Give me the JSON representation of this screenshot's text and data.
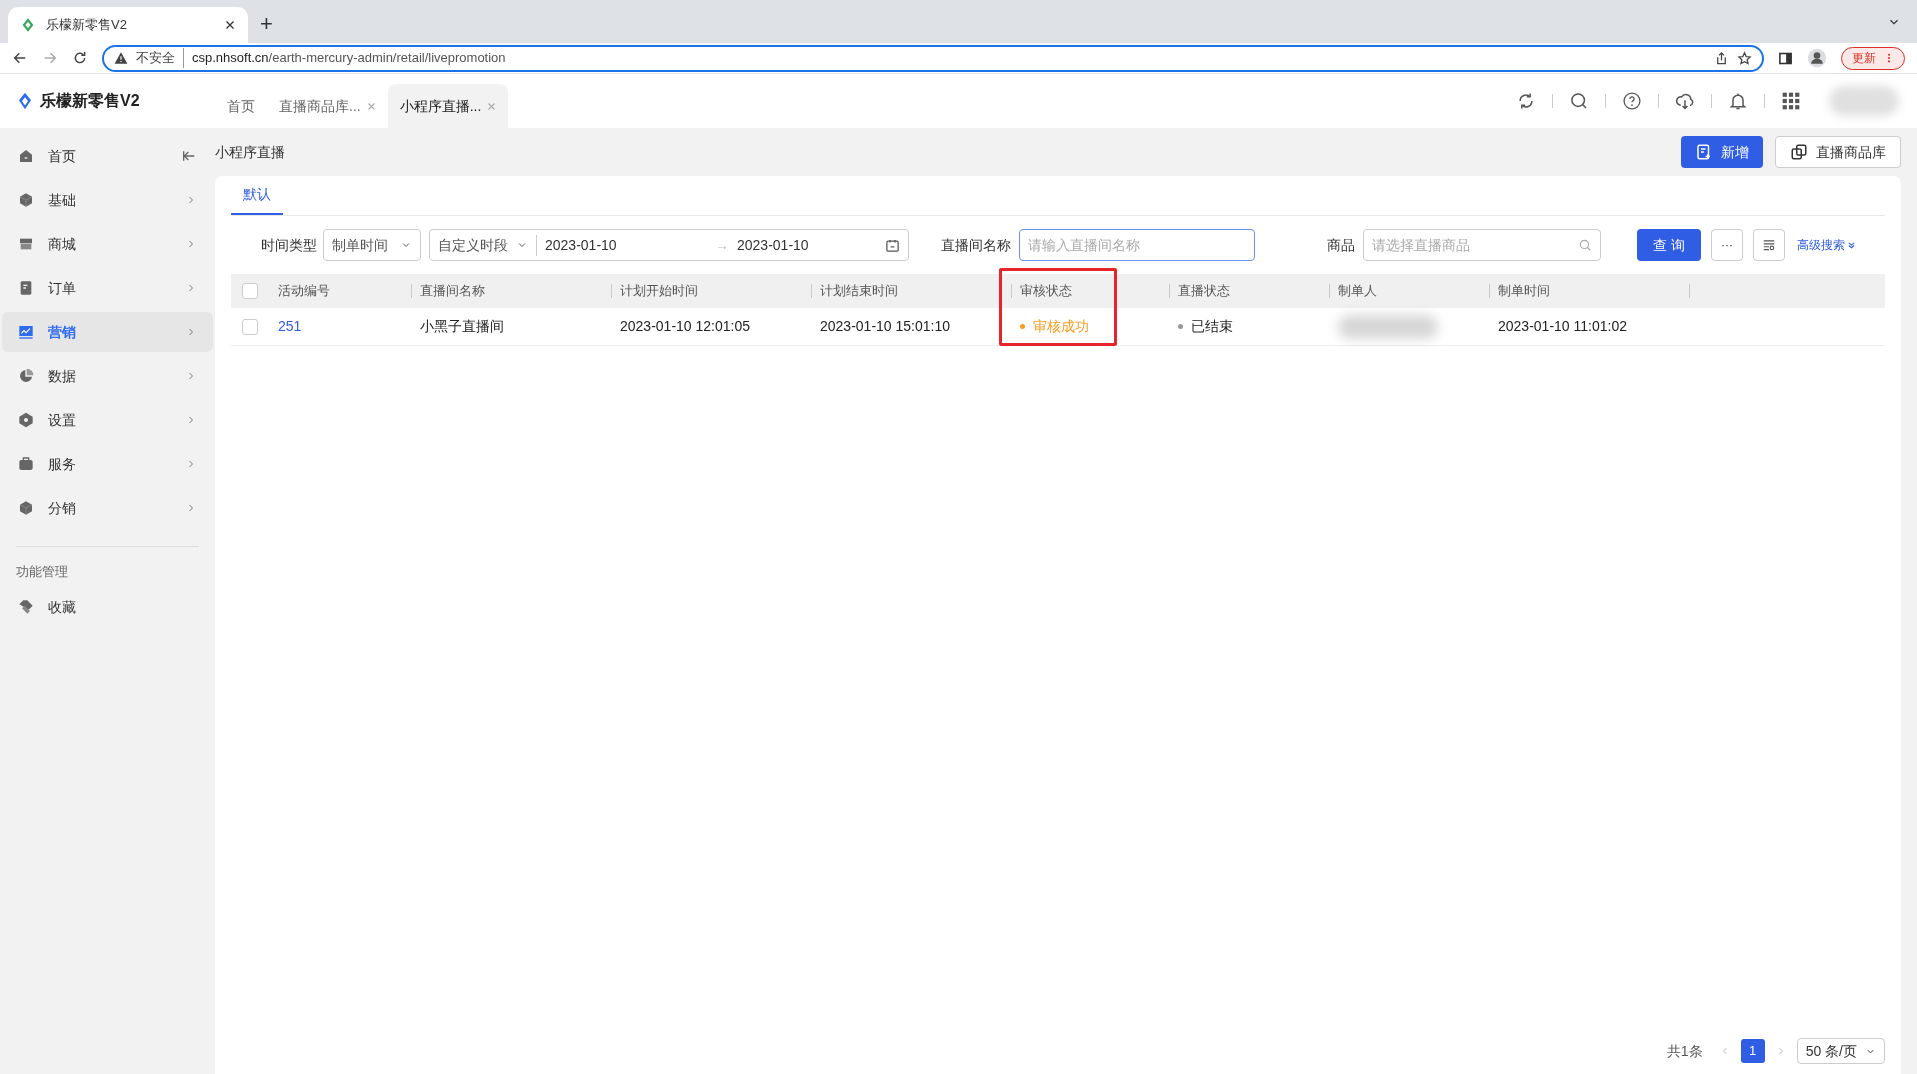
{
  "browser": {
    "tab_title": "乐檬新零售V2",
    "new_tab": "+",
    "security": "不安全",
    "url_host": "csp.nhsoft.cn",
    "url_path": "/earth-mercury-admin/retail/livepromotion",
    "update_button": "更新"
  },
  "app": {
    "logo_text": "乐檬新零售V2"
  },
  "page_tabs": [
    {
      "label": "首页",
      "selected": false,
      "closable": false
    },
    {
      "label": "直播商品库...",
      "selected": false,
      "closable": true
    },
    {
      "label": "小程序直播...",
      "selected": true,
      "closable": true
    }
  ],
  "sidebar": {
    "items": [
      {
        "label": "首页",
        "selected": false,
        "kind": "collapse"
      },
      {
        "label": "基础",
        "selected": false,
        "kind": "submenu"
      },
      {
        "label": "商城",
        "selected": false,
        "kind": "submenu"
      },
      {
        "label": "订单",
        "selected": false,
        "kind": "submenu"
      },
      {
        "label": "营销",
        "selected": true,
        "kind": "submenu"
      },
      {
        "label": "数据",
        "selected": false,
        "kind": "submenu"
      },
      {
        "label": "设置",
        "selected": false,
        "kind": "submenu"
      },
      {
        "label": "服务",
        "selected": false,
        "kind": "submenu"
      },
      {
        "label": "分销",
        "selected": false,
        "kind": "submenu"
      }
    ],
    "section_title": "功能管理",
    "section_items": [
      {
        "label": "收藏",
        "selected": false
      }
    ]
  },
  "page_title": "小程序直播",
  "actions": [
    "新增",
    "直播商品库"
  ],
  "view_tabs": [
    {
      "label": "默认",
      "selected": true
    }
  ],
  "filters": {
    "time_type_label": "时间类型",
    "time_type_value": "制单时间",
    "period_value": "自定义时段",
    "date_from": "2023-01-10",
    "date_separator": "→",
    "date_to": "2023-01-10",
    "room_label": "直播间名称",
    "room_placeholder": "请输入直播间名称",
    "product_label": "商品",
    "product_placeholder": "请选择直播商品",
    "query_button": "查 询",
    "more_button": "···",
    "advanced_search": "高级搜索"
  },
  "table": {
    "select_all_checked": false,
    "columns": [
      {
        "label": "活动编号",
        "highlighted": false
      },
      {
        "label": "直播间名称",
        "highlighted": false
      },
      {
        "label": "计划开始时间",
        "highlighted": false
      },
      {
        "label": "计划结束时间",
        "highlighted": false
      },
      {
        "label": "审核状态",
        "highlighted": true
      },
      {
        "label": "直播状态",
        "highlighted": false
      },
      {
        "label": "制单人",
        "highlighted": false
      },
      {
        "label": "制单时间",
        "highlighted": false
      }
    ],
    "rows": [
      {
        "checked": false,
        "id": "251",
        "room": "小黑子直播间",
        "start": "2023-01-10 12:01:05",
        "end": "2023-01-10 15:01:10",
        "audit_status": {
          "label": "审核成功",
          "color": "#fa9c1e"
        },
        "live_status": {
          "label": "已结束",
          "color": "#999999"
        },
        "maker_redacted": true,
        "created": "2023-01-10 11:01:02"
      }
    ]
  },
  "pagination": {
    "total": "共1条",
    "pages": [
      {
        "label": "1",
        "selected": true
      }
    ],
    "page_size": "50 条/页"
  }
}
